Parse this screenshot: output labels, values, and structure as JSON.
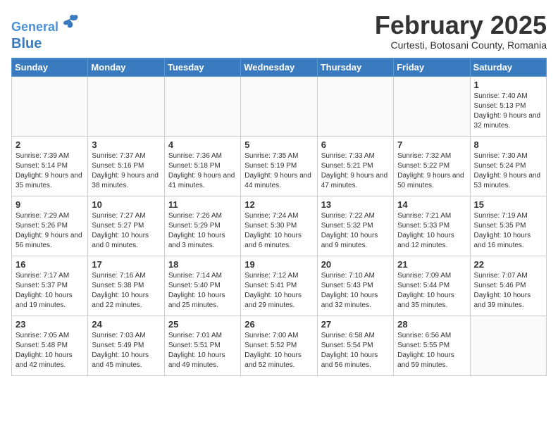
{
  "header": {
    "logo_line1": "General",
    "logo_line2": "Blue",
    "title": "February 2025",
    "subtitle": "Curtesti, Botosani County, Romania"
  },
  "weekdays": [
    "Sunday",
    "Monday",
    "Tuesday",
    "Wednesday",
    "Thursday",
    "Friday",
    "Saturday"
  ],
  "weeks": [
    [
      {
        "day": "",
        "info": ""
      },
      {
        "day": "",
        "info": ""
      },
      {
        "day": "",
        "info": ""
      },
      {
        "day": "",
        "info": ""
      },
      {
        "day": "",
        "info": ""
      },
      {
        "day": "",
        "info": ""
      },
      {
        "day": "1",
        "info": "Sunrise: 7:40 AM\nSunset: 5:13 PM\nDaylight: 9 hours and 32 minutes."
      }
    ],
    [
      {
        "day": "2",
        "info": "Sunrise: 7:39 AM\nSunset: 5:14 PM\nDaylight: 9 hours and 35 minutes."
      },
      {
        "day": "3",
        "info": "Sunrise: 7:37 AM\nSunset: 5:16 PM\nDaylight: 9 hours and 38 minutes."
      },
      {
        "day": "4",
        "info": "Sunrise: 7:36 AM\nSunset: 5:18 PM\nDaylight: 9 hours and 41 minutes."
      },
      {
        "day": "5",
        "info": "Sunrise: 7:35 AM\nSunset: 5:19 PM\nDaylight: 9 hours and 44 minutes."
      },
      {
        "day": "6",
        "info": "Sunrise: 7:33 AM\nSunset: 5:21 PM\nDaylight: 9 hours and 47 minutes."
      },
      {
        "day": "7",
        "info": "Sunrise: 7:32 AM\nSunset: 5:22 PM\nDaylight: 9 hours and 50 minutes."
      },
      {
        "day": "8",
        "info": "Sunrise: 7:30 AM\nSunset: 5:24 PM\nDaylight: 9 hours and 53 minutes."
      }
    ],
    [
      {
        "day": "9",
        "info": "Sunrise: 7:29 AM\nSunset: 5:26 PM\nDaylight: 9 hours and 56 minutes."
      },
      {
        "day": "10",
        "info": "Sunrise: 7:27 AM\nSunset: 5:27 PM\nDaylight: 10 hours and 0 minutes."
      },
      {
        "day": "11",
        "info": "Sunrise: 7:26 AM\nSunset: 5:29 PM\nDaylight: 10 hours and 3 minutes."
      },
      {
        "day": "12",
        "info": "Sunrise: 7:24 AM\nSunset: 5:30 PM\nDaylight: 10 hours and 6 minutes."
      },
      {
        "day": "13",
        "info": "Sunrise: 7:22 AM\nSunset: 5:32 PM\nDaylight: 10 hours and 9 minutes."
      },
      {
        "day": "14",
        "info": "Sunrise: 7:21 AM\nSunset: 5:33 PM\nDaylight: 10 hours and 12 minutes."
      },
      {
        "day": "15",
        "info": "Sunrise: 7:19 AM\nSunset: 5:35 PM\nDaylight: 10 hours and 16 minutes."
      }
    ],
    [
      {
        "day": "16",
        "info": "Sunrise: 7:17 AM\nSunset: 5:37 PM\nDaylight: 10 hours and 19 minutes."
      },
      {
        "day": "17",
        "info": "Sunrise: 7:16 AM\nSunset: 5:38 PM\nDaylight: 10 hours and 22 minutes."
      },
      {
        "day": "18",
        "info": "Sunrise: 7:14 AM\nSunset: 5:40 PM\nDaylight: 10 hours and 25 minutes."
      },
      {
        "day": "19",
        "info": "Sunrise: 7:12 AM\nSunset: 5:41 PM\nDaylight: 10 hours and 29 minutes."
      },
      {
        "day": "20",
        "info": "Sunrise: 7:10 AM\nSunset: 5:43 PM\nDaylight: 10 hours and 32 minutes."
      },
      {
        "day": "21",
        "info": "Sunrise: 7:09 AM\nSunset: 5:44 PM\nDaylight: 10 hours and 35 minutes."
      },
      {
        "day": "22",
        "info": "Sunrise: 7:07 AM\nSunset: 5:46 PM\nDaylight: 10 hours and 39 minutes."
      }
    ],
    [
      {
        "day": "23",
        "info": "Sunrise: 7:05 AM\nSunset: 5:48 PM\nDaylight: 10 hours and 42 minutes."
      },
      {
        "day": "24",
        "info": "Sunrise: 7:03 AM\nSunset: 5:49 PM\nDaylight: 10 hours and 45 minutes."
      },
      {
        "day": "25",
        "info": "Sunrise: 7:01 AM\nSunset: 5:51 PM\nDaylight: 10 hours and 49 minutes."
      },
      {
        "day": "26",
        "info": "Sunrise: 7:00 AM\nSunset: 5:52 PM\nDaylight: 10 hours and 52 minutes."
      },
      {
        "day": "27",
        "info": "Sunrise: 6:58 AM\nSunset: 5:54 PM\nDaylight: 10 hours and 56 minutes."
      },
      {
        "day": "28",
        "info": "Sunrise: 6:56 AM\nSunset: 5:55 PM\nDaylight: 10 hours and 59 minutes."
      },
      {
        "day": "",
        "info": ""
      }
    ]
  ]
}
